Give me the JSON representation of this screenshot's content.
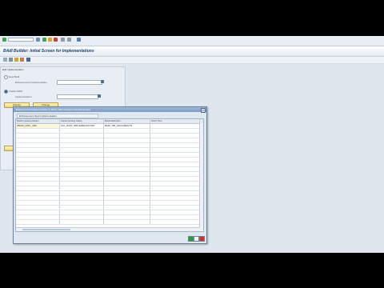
{
  "window": {
    "title": "BAdI Builder: Initial Screen for Implementations"
  },
  "colors": {
    "accent": "#1a3f6f",
    "dialog_title_bg": "#7d9cc2",
    "selected_cell": "#fff9d9",
    "ok_icon": "#2e9b3f",
    "cancel_icon": "#c9302c"
  },
  "group": {
    "title": "Edit Implementation",
    "radio1_label": "New BAdI",
    "field1_label": "Enhancement Implementation",
    "radio2_label": "Classic BAdI",
    "field2_label": "Implementation",
    "display_btn": "Display",
    "change_btn": "Change"
  },
  "dialog": {
    "title": "Enhancement Implementation Z_BAdI_ABC (Assign to Enhancement)",
    "tab_label": "Enhancement Spot Implementation",
    "columns": [
      "BAdI Implementation",
      "Implementing Class",
      "BAdI Definition",
      "Short Text"
    ],
    "rows": [
      [
        "ZBADI_IMPL_ABC",
        "ZCL_BADI_IMPLEMENTATION",
        "BADI_MB_DOCUMENTS",
        ""
      ]
    ]
  }
}
